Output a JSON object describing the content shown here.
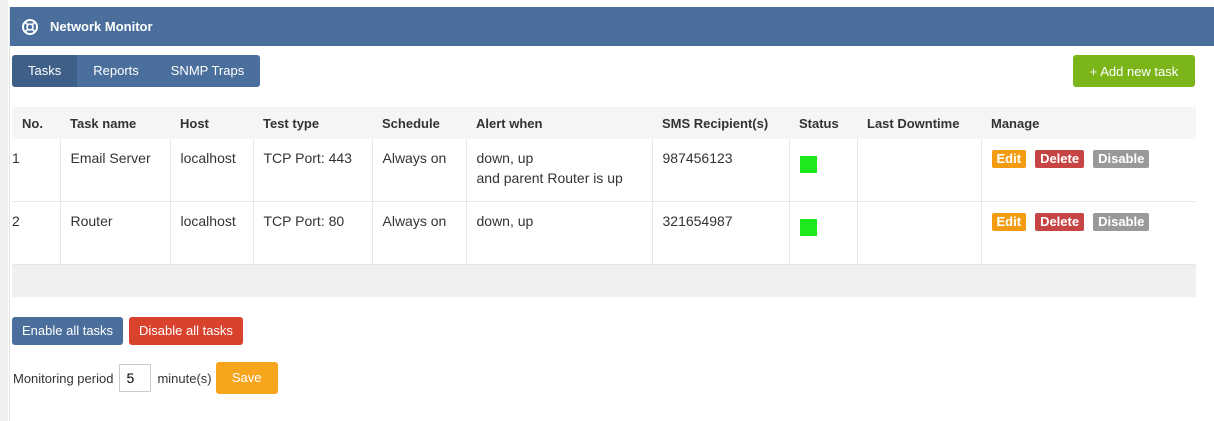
{
  "header": {
    "title": "Network Monitor"
  },
  "tabs": [
    {
      "label": "Tasks"
    },
    {
      "label": "Reports"
    },
    {
      "label": "SNMP Traps"
    }
  ],
  "toolbar": {
    "add_label": "+ Add new task"
  },
  "table": {
    "columns": [
      "No.",
      "Task name",
      "Host",
      "Test type",
      "Schedule",
      "Alert when",
      "SMS Recipient(s)",
      "Status",
      "Last Downtime",
      "Manage"
    ],
    "rows": [
      {
        "no": "1",
        "task": "Email Server",
        "host": "localhost",
        "test": "TCP Port: 443",
        "schedule": "Always on",
        "alert1": "down, up",
        "alert2": "and parent Router is up",
        "sms": "987456123",
        "downtime": ""
      },
      {
        "no": "2",
        "task": "Router",
        "host": "localhost",
        "test": "TCP Port: 80",
        "schedule": "Always on",
        "alert1": "down, up",
        "alert2": "",
        "sms": "321654987",
        "downtime": ""
      }
    ],
    "manage": {
      "edit": "Edit",
      "delete": "Delete",
      "disable": "Disable"
    }
  },
  "actions": {
    "enable_all": "Enable all tasks",
    "disable_all": "Disable all tasks"
  },
  "period": {
    "label": "Monitoring period",
    "value": "5",
    "unit": "minute(s)",
    "save": "Save"
  },
  "colors": {
    "header": "#4a6f9c",
    "status_up": "#1ee81e",
    "add": "#7bb51a",
    "save": "#f7a51d"
  }
}
